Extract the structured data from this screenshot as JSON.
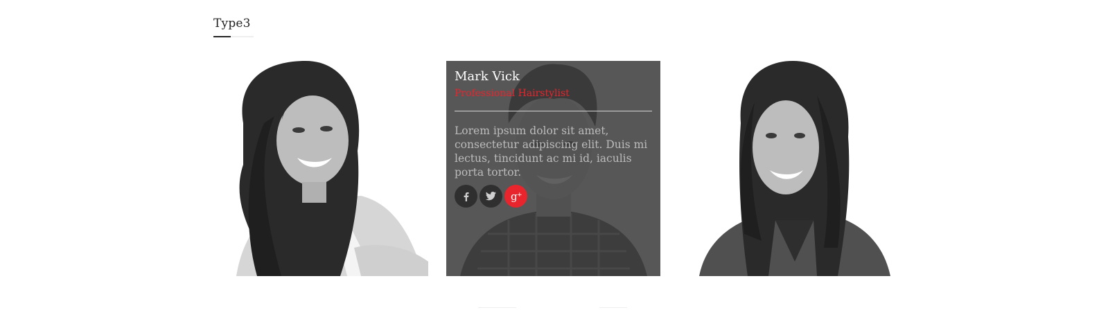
{
  "section": {
    "heading": "Type3"
  },
  "team": [
    {
      "photo": "woman-curly-hair-portrait"
    },
    {
      "photo": "man-plaid-shirt-portrait",
      "name": "Mark Vick",
      "role": "Professional Hairstylist",
      "bio": "Lorem ipsum dolor sit amet, consectetur adipiscing elit. Duis mi lectus, tincidunt ac mi id, iaculis porta tortor.",
      "social": [
        {
          "icon": "facebook-icon",
          "glyph": "f"
        },
        {
          "icon": "twitter-icon",
          "glyph": "t"
        },
        {
          "icon": "google-plus-icon",
          "glyph": "g+"
        }
      ]
    },
    {
      "photo": "woman-straight-hair-portrait"
    }
  ],
  "colors": {
    "accent": "#e8242c",
    "overlay": "#3e3e3e",
    "heading": "#222222"
  }
}
